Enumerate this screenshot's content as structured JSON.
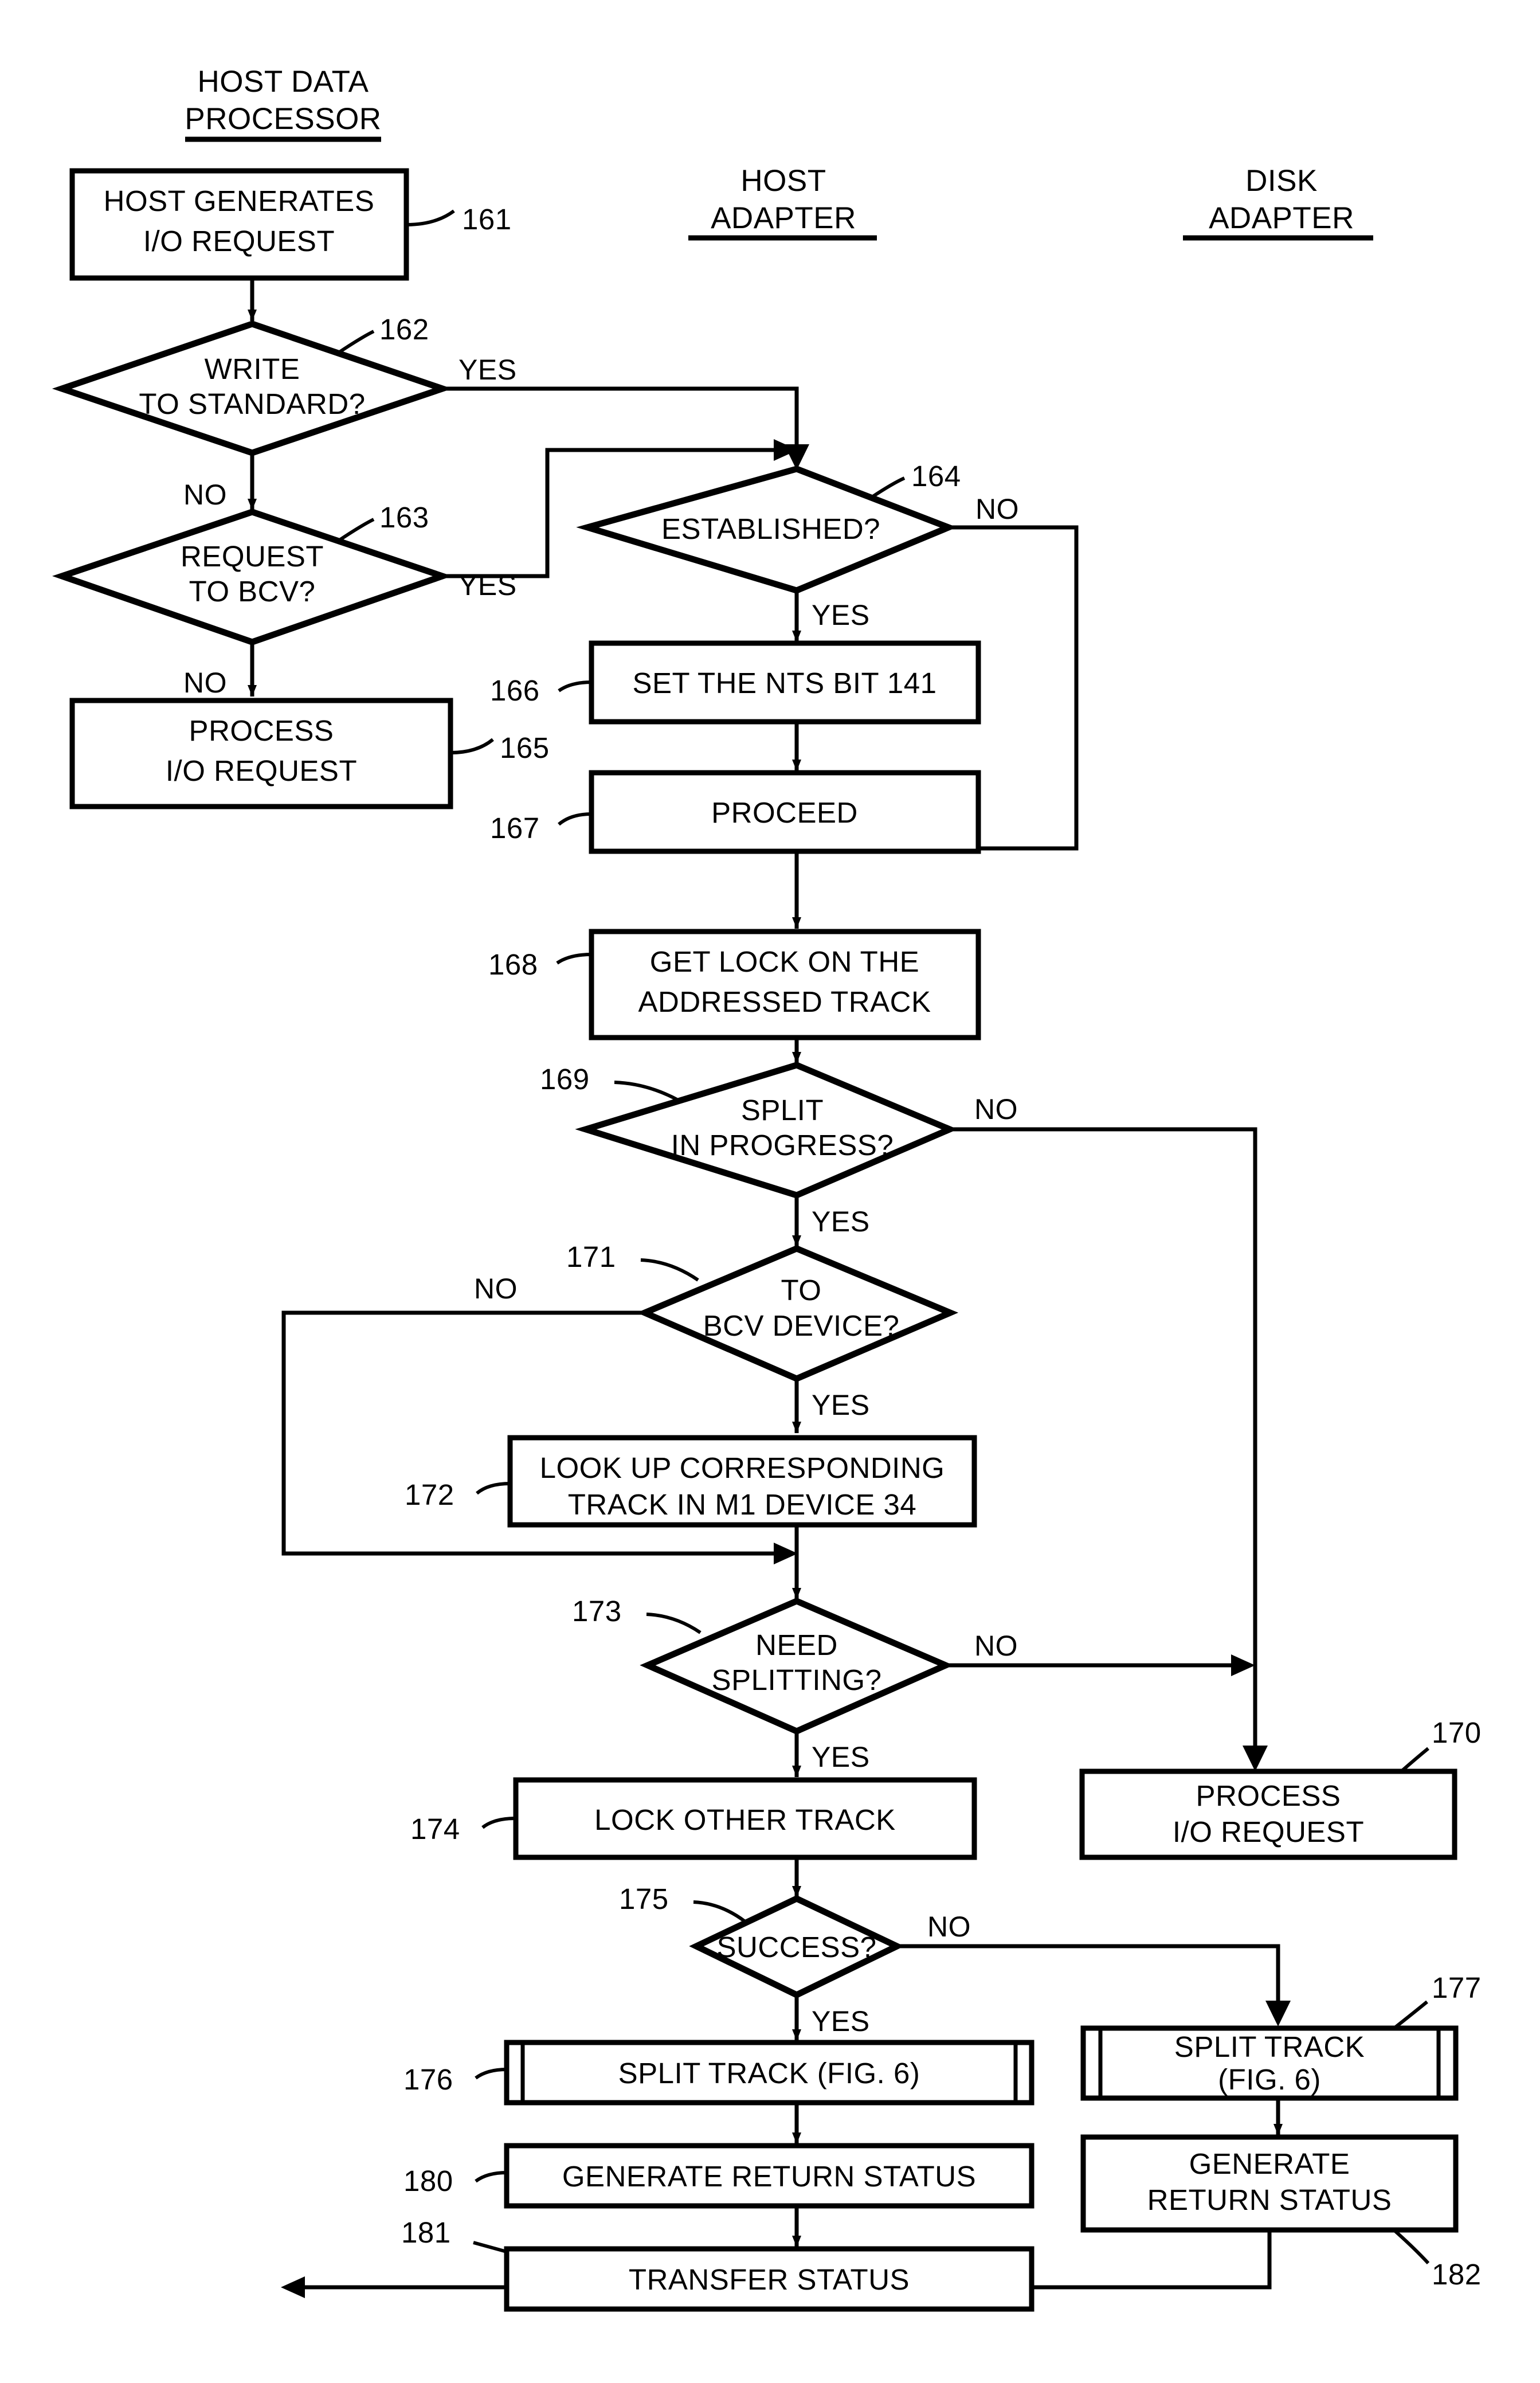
{
  "figure": {
    "type": "patent-flowchart",
    "columns": [
      {
        "id": "host-data-processor",
        "line1": "HOST DATA",
        "line2": "PROCESSOR"
      },
      {
        "id": "host-adapter",
        "line1": "HOST",
        "line2": "ADAPTER"
      },
      {
        "id": "disk-adapter",
        "line1": "DISK",
        "line2": "ADAPTER"
      }
    ],
    "labels": {
      "yes": "YES",
      "no": "NO"
    },
    "nodes": [
      {
        "ref": "161",
        "kind": "process",
        "lines": [
          "HOST GENERATES",
          "I/O REQUEST"
        ],
        "column": "host-data-processor"
      },
      {
        "ref": "162",
        "kind": "decision",
        "lines": [
          "WRITE",
          "TO STANDARD?"
        ],
        "column": "host-data-processor"
      },
      {
        "ref": "163",
        "kind": "decision",
        "lines": [
          "REQUEST",
          "TO BCV?"
        ],
        "column": "host-data-processor"
      },
      {
        "ref": "165",
        "kind": "process",
        "lines": [
          "PROCESS",
          "I/O REQUEST"
        ],
        "column": "host-data-processor"
      },
      {
        "ref": "164",
        "kind": "decision",
        "lines": [
          "ESTABLISHED?"
        ],
        "column": "host-adapter"
      },
      {
        "ref": "166",
        "kind": "process",
        "lines": [
          "SET THE NTS BIT 141"
        ],
        "column": "host-adapter"
      },
      {
        "ref": "167",
        "kind": "process",
        "lines": [
          "PROCEED"
        ],
        "column": "host-adapter"
      },
      {
        "ref": "168",
        "kind": "process",
        "lines": [
          "GET LOCK ON THE",
          "ADDRESSED TRACK"
        ],
        "column": "host-adapter"
      },
      {
        "ref": "169",
        "kind": "decision",
        "lines": [
          "SPLIT",
          "IN PROGRESS?"
        ],
        "column": "host-adapter"
      },
      {
        "ref": "171",
        "kind": "decision",
        "lines": [
          "TO",
          "BCV DEVICE?"
        ],
        "column": "host-adapter"
      },
      {
        "ref": "172",
        "kind": "process",
        "lines": [
          "LOOK UP CORRESPONDING",
          "TRACK IN M1 DEVICE 34"
        ],
        "column": "host-adapter"
      },
      {
        "ref": "173",
        "kind": "decision",
        "lines": [
          "NEED",
          "SPLITTING?"
        ],
        "column": "host-adapter"
      },
      {
        "ref": "174",
        "kind": "process",
        "lines": [
          "LOCK OTHER TRACK"
        ],
        "column": "host-adapter"
      },
      {
        "ref": "175",
        "kind": "decision",
        "lines": [
          "SUCCESS?"
        ],
        "column": "host-adapter"
      },
      {
        "ref": "176",
        "kind": "predefined-process",
        "lines": [
          "SPLIT TRACK (FIG. 6)"
        ],
        "column": "host-adapter"
      },
      {
        "ref": "180",
        "kind": "process",
        "lines": [
          "GENERATE RETURN STATUS"
        ],
        "column": "host-adapter"
      },
      {
        "ref": "181",
        "kind": "process",
        "lines": [
          "TRANSFER STATUS"
        ],
        "column": "host-adapter"
      },
      {
        "ref": "170",
        "kind": "process",
        "lines": [
          "PROCESS",
          "I/O REQUEST"
        ],
        "column": "disk-adapter"
      },
      {
        "ref": "177",
        "kind": "predefined-process",
        "lines": [
          "SPLIT TRACK",
          "(FIG. 6)"
        ],
        "column": "disk-adapter"
      },
      {
        "ref": "182",
        "kind": "process",
        "lines": [
          "GENERATE",
          "RETURN STATUS"
        ],
        "column": "disk-adapter"
      }
    ],
    "text": {
      "col1_l1": "HOST DATA",
      "col1_l2": "PROCESSOR",
      "col2_l1": "HOST",
      "col2_l2": "ADAPTER",
      "col3_l1": "DISK",
      "col3_l2": "ADAPTER",
      "n161_l1": "HOST GENERATES",
      "n161_l2": "I/O REQUEST",
      "n162_l1": "WRITE",
      "n162_l2": "TO STANDARD?",
      "n163_l1": "REQUEST",
      "n163_l2": "TO BCV?",
      "n165_l1": "PROCESS",
      "n165_l2": "I/O REQUEST",
      "n164_l1": "ESTABLISHED?",
      "n166_l1": "SET THE NTS BIT 141",
      "n167_l1": "PROCEED",
      "n168_l1": "GET LOCK ON THE",
      "n168_l2": "ADDRESSED TRACK",
      "n169_l1": "SPLIT",
      "n169_l2": "IN PROGRESS?",
      "n171_l1": "TO",
      "n171_l2": "BCV DEVICE?",
      "n172_l1": "LOOK UP CORRESPONDING",
      "n172_l2": "TRACK IN M1 DEVICE 34",
      "n173_l1": "NEED",
      "n173_l2": "SPLITTING?",
      "n174_l1": "LOCK OTHER TRACK",
      "n175_l1": "SUCCESS?",
      "n176_l1": "SPLIT TRACK (FIG. 6)",
      "n180_l1": "GENERATE RETURN STATUS",
      "n181_l1": "TRANSFER STATUS",
      "n170_l1": "PROCESS",
      "n170_l2": "I/O REQUEST",
      "n177_l1": "SPLIT TRACK",
      "n177_l2": "(FIG. 6)",
      "n182_l1": "GENERATE",
      "n182_l2": "RETURN STATUS",
      "ref161": "161",
      "ref162": "162",
      "ref163": "163",
      "ref164": "164",
      "ref165": "165",
      "ref166": "166",
      "ref167": "167",
      "ref168": "168",
      "ref169": "169",
      "ref170": "170",
      "ref171": "171",
      "ref172": "172",
      "ref173": "173",
      "ref174": "174",
      "ref175": "175",
      "ref176": "176",
      "ref177": "177",
      "ref180": "180",
      "ref181": "181",
      "ref182": "182",
      "yes162": "YES",
      "no162": "NO",
      "yes163": "YES",
      "no163": "NO",
      "yes164": "YES",
      "no164": "NO",
      "yes169": "YES",
      "no169": "NO",
      "yes171": "YES",
      "no171": "NO",
      "yes173": "YES",
      "no173": "NO",
      "yes175": "YES",
      "no175": "NO"
    }
  }
}
